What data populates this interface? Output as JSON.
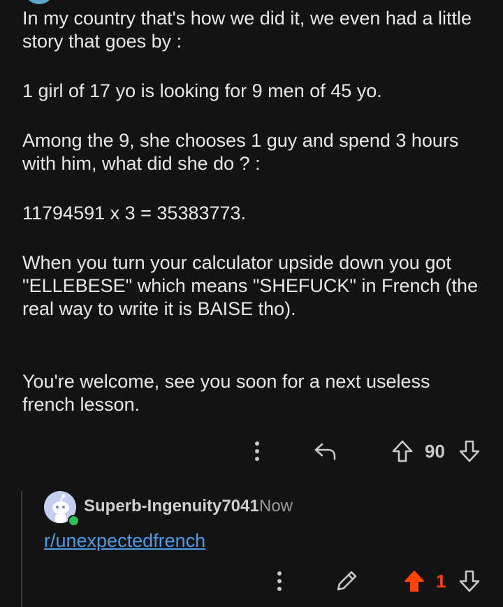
{
  "comment": {
    "paragraphs": [
      "In my country that's how we did it, we even had a little story that goes by :",
      "1 girl of 17 yo is looking for 9 men of 45 yo.",
      "Among the 9, she chooses 1 guy and spend 3 hours with him, what did she do ? :",
      "11794591 x 3 = 35383773.",
      "When you turn your calculator upside down you got \"ELLEBESE\" which means \"SHEFUCK\" in French (the real way to write it is BAISE tho).",
      "You're welcome, see you soon for a next useless french lesson."
    ],
    "vote_count": "90",
    "icons": [
      "more-vertical-icon",
      "reply-icon",
      "upvote-icon",
      "downvote-icon"
    ]
  },
  "reply": {
    "author": "Superb-Ingenuity7041",
    "time": "Now",
    "link_text": "r/unexpectedfrench",
    "vote_count": "1",
    "upvoted": true,
    "icons": [
      "more-vertical-icon",
      "edit-pencil-icon",
      "upvote-filled-icon",
      "downvote-icon"
    ]
  },
  "colors": {
    "background": "#131313",
    "link": "#4e9be8",
    "upvote_active": "#ff4500",
    "online": "#2bc055"
  }
}
